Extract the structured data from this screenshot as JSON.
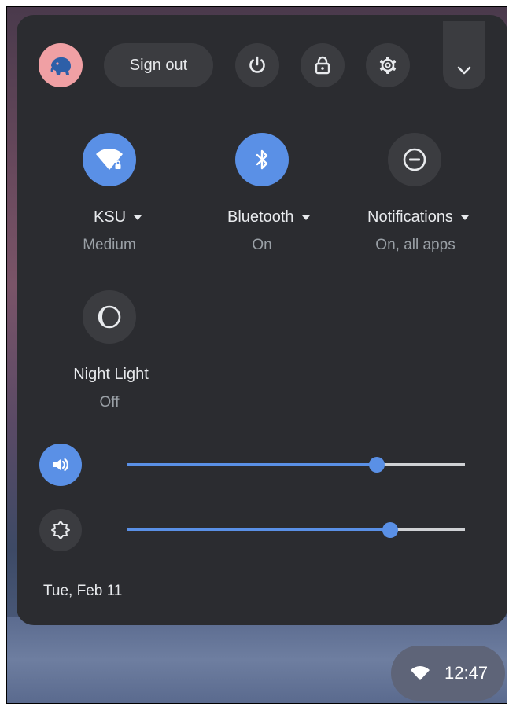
{
  "header": {
    "sign_out_label": "Sign out"
  },
  "tiles": [
    {
      "label": "KSU",
      "sub": "Medium",
      "icon": "wifi-secure-icon",
      "active": true
    },
    {
      "label": "Bluetooth",
      "sub": "On",
      "icon": "bluetooth-icon",
      "active": true
    },
    {
      "label": "Notifications",
      "sub": "On, all apps",
      "icon": "do-not-disturb-icon",
      "active": false
    },
    {
      "label": "Night Light",
      "sub": "Off",
      "icon": "night-light-icon",
      "active": false
    }
  ],
  "sliders": {
    "volume": {
      "icon": "volume-icon",
      "level": 0.74
    },
    "brightness": {
      "icon": "brightness-icon",
      "level": 0.78
    }
  },
  "date_text": "Tue, Feb 11",
  "tray": {
    "time": "12:47",
    "icon": "wifi-icon"
  },
  "colors": {
    "accent": "#5a90e6",
    "panel": "#2b2c30",
    "button": "#3b3c40",
    "track_off": "#cfd1d4"
  }
}
